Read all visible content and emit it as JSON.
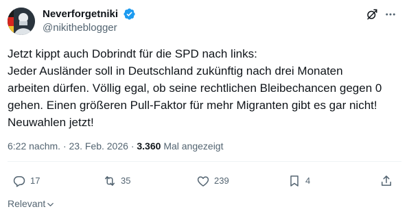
{
  "author": {
    "name": "Neverforgetniki",
    "handle": "@nikitheblogger",
    "verified": true
  },
  "tweet": {
    "lines": [
      "Jetzt kippt auch Dobrindt für die SPD nach links:",
      "Jeder Ausländer soll in Deutschland zukünftig nach drei Monaten",
      "arbeiten dürfen. Völlig egal, ob seine rechtlichen Bleibechancen gegen 0",
      "gehen. Einen größeren Pull-Faktor für mehr Migranten gibt es gar nicht!",
      "Neuwahlen jetzt!"
    ],
    "time": "6:22 nachm.",
    "separator": "·",
    "date": "23. Feb. 2026",
    "views_count": "3.360",
    "views_label": "Mal angezeigt"
  },
  "actions": {
    "replies": "17",
    "reposts": "35",
    "likes": "239",
    "bookmarks": "4"
  },
  "sort": {
    "label": "Relevant"
  },
  "colors": {
    "verified_blue": "#1d9bf0",
    "text_primary": "#0f1419",
    "text_secondary": "#536471"
  },
  "icons": [
    "verified-badge-icon",
    "grok-icon",
    "more-icon",
    "reply-icon",
    "repost-icon",
    "like-icon",
    "bookmark-icon",
    "share-icon",
    "chevron-down-icon"
  ]
}
